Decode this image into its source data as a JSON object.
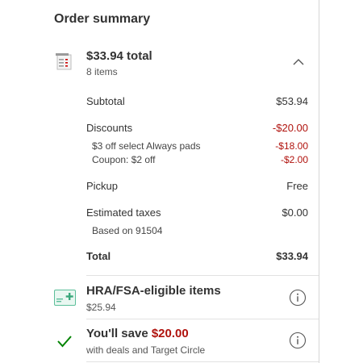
{
  "header": {
    "title": "Order summary"
  },
  "summary": {
    "total_label": "$33.94 total",
    "items_count": "8 items",
    "toggle_icon": "chevron-up-icon"
  },
  "lines": {
    "subtotal": {
      "label": "Subtotal",
      "value": "$53.94"
    },
    "discounts": {
      "label": "Discounts",
      "value": "-$20.00",
      "items": [
        {
          "label": "$3 off select Always pads",
          "value": "-$18.00"
        },
        {
          "label": "Coupon: $2 off",
          "value": "-$2.00"
        }
      ]
    },
    "pickup": {
      "label": "Pickup",
      "value": "Free"
    },
    "taxes": {
      "label": "Estimated taxes",
      "value": "$0.00",
      "note": "Based on 91504"
    },
    "total": {
      "label": "Total",
      "value": "$33.94"
    }
  },
  "hra": {
    "icon": "hra-fsa-card-icon",
    "title": "HRA/FSA-eligible items",
    "amount": "$25.94",
    "info_icon": "info-icon"
  },
  "savings": {
    "icon": "checkmark-icon",
    "prefix": "You'll save ",
    "amount": "$20.00",
    "subtitle": "with deals and Target Circle",
    "info_icon": "info-icon"
  },
  "colors": {
    "text": "#333333",
    "discount_red": "#b0120d",
    "check_green": "#008300",
    "divider": "#e2e2e2"
  }
}
